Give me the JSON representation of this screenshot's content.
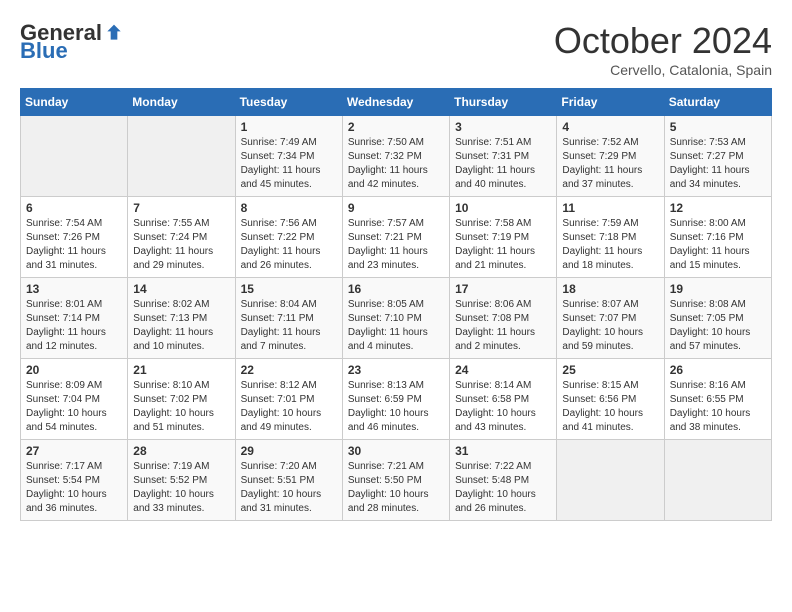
{
  "header": {
    "logo_general": "General",
    "logo_blue": "Blue",
    "month_title": "October 2024",
    "subtitle": "Cervello, Catalonia, Spain"
  },
  "days_of_week": [
    "Sunday",
    "Monday",
    "Tuesday",
    "Wednesday",
    "Thursday",
    "Friday",
    "Saturday"
  ],
  "weeks": [
    [
      {
        "day": "",
        "info": ""
      },
      {
        "day": "",
        "info": ""
      },
      {
        "day": "1",
        "info": "Sunrise: 7:49 AM\nSunset: 7:34 PM\nDaylight: 11 hours and 45 minutes."
      },
      {
        "day": "2",
        "info": "Sunrise: 7:50 AM\nSunset: 7:32 PM\nDaylight: 11 hours and 42 minutes."
      },
      {
        "day": "3",
        "info": "Sunrise: 7:51 AM\nSunset: 7:31 PM\nDaylight: 11 hours and 40 minutes."
      },
      {
        "day": "4",
        "info": "Sunrise: 7:52 AM\nSunset: 7:29 PM\nDaylight: 11 hours and 37 minutes."
      },
      {
        "day": "5",
        "info": "Sunrise: 7:53 AM\nSunset: 7:27 PM\nDaylight: 11 hours and 34 minutes."
      }
    ],
    [
      {
        "day": "6",
        "info": "Sunrise: 7:54 AM\nSunset: 7:26 PM\nDaylight: 11 hours and 31 minutes."
      },
      {
        "day": "7",
        "info": "Sunrise: 7:55 AM\nSunset: 7:24 PM\nDaylight: 11 hours and 29 minutes."
      },
      {
        "day": "8",
        "info": "Sunrise: 7:56 AM\nSunset: 7:22 PM\nDaylight: 11 hours and 26 minutes."
      },
      {
        "day": "9",
        "info": "Sunrise: 7:57 AM\nSunset: 7:21 PM\nDaylight: 11 hours and 23 minutes."
      },
      {
        "day": "10",
        "info": "Sunrise: 7:58 AM\nSunset: 7:19 PM\nDaylight: 11 hours and 21 minutes."
      },
      {
        "day": "11",
        "info": "Sunrise: 7:59 AM\nSunset: 7:18 PM\nDaylight: 11 hours and 18 minutes."
      },
      {
        "day": "12",
        "info": "Sunrise: 8:00 AM\nSunset: 7:16 PM\nDaylight: 11 hours and 15 minutes."
      }
    ],
    [
      {
        "day": "13",
        "info": "Sunrise: 8:01 AM\nSunset: 7:14 PM\nDaylight: 11 hours and 12 minutes."
      },
      {
        "day": "14",
        "info": "Sunrise: 8:02 AM\nSunset: 7:13 PM\nDaylight: 11 hours and 10 minutes."
      },
      {
        "day": "15",
        "info": "Sunrise: 8:04 AM\nSunset: 7:11 PM\nDaylight: 11 hours and 7 minutes."
      },
      {
        "day": "16",
        "info": "Sunrise: 8:05 AM\nSunset: 7:10 PM\nDaylight: 11 hours and 4 minutes."
      },
      {
        "day": "17",
        "info": "Sunrise: 8:06 AM\nSunset: 7:08 PM\nDaylight: 11 hours and 2 minutes."
      },
      {
        "day": "18",
        "info": "Sunrise: 8:07 AM\nSunset: 7:07 PM\nDaylight: 10 hours and 59 minutes."
      },
      {
        "day": "19",
        "info": "Sunrise: 8:08 AM\nSunset: 7:05 PM\nDaylight: 10 hours and 57 minutes."
      }
    ],
    [
      {
        "day": "20",
        "info": "Sunrise: 8:09 AM\nSunset: 7:04 PM\nDaylight: 10 hours and 54 minutes."
      },
      {
        "day": "21",
        "info": "Sunrise: 8:10 AM\nSunset: 7:02 PM\nDaylight: 10 hours and 51 minutes."
      },
      {
        "day": "22",
        "info": "Sunrise: 8:12 AM\nSunset: 7:01 PM\nDaylight: 10 hours and 49 minutes."
      },
      {
        "day": "23",
        "info": "Sunrise: 8:13 AM\nSunset: 6:59 PM\nDaylight: 10 hours and 46 minutes."
      },
      {
        "day": "24",
        "info": "Sunrise: 8:14 AM\nSunset: 6:58 PM\nDaylight: 10 hours and 43 minutes."
      },
      {
        "day": "25",
        "info": "Sunrise: 8:15 AM\nSunset: 6:56 PM\nDaylight: 10 hours and 41 minutes."
      },
      {
        "day": "26",
        "info": "Sunrise: 8:16 AM\nSunset: 6:55 PM\nDaylight: 10 hours and 38 minutes."
      }
    ],
    [
      {
        "day": "27",
        "info": "Sunrise: 7:17 AM\nSunset: 5:54 PM\nDaylight: 10 hours and 36 minutes."
      },
      {
        "day": "28",
        "info": "Sunrise: 7:19 AM\nSunset: 5:52 PM\nDaylight: 10 hours and 33 minutes."
      },
      {
        "day": "29",
        "info": "Sunrise: 7:20 AM\nSunset: 5:51 PM\nDaylight: 10 hours and 31 minutes."
      },
      {
        "day": "30",
        "info": "Sunrise: 7:21 AM\nSunset: 5:50 PM\nDaylight: 10 hours and 28 minutes."
      },
      {
        "day": "31",
        "info": "Sunrise: 7:22 AM\nSunset: 5:48 PM\nDaylight: 10 hours and 26 minutes."
      },
      {
        "day": "",
        "info": ""
      },
      {
        "day": "",
        "info": ""
      }
    ]
  ]
}
